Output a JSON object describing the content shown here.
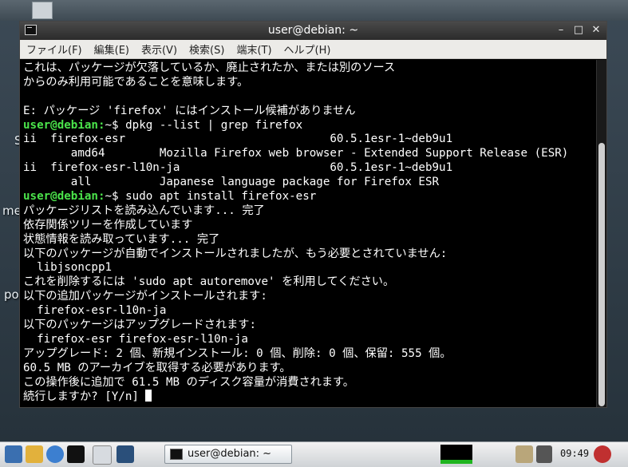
{
  "window": {
    "title": "user@debian: ~",
    "minimize_glyph": "–",
    "maximize_glyph": "□",
    "close_glyph": "✕"
  },
  "menu": [
    "ファイル(F)",
    "編集(E)",
    "表示(V)",
    "検索(S)",
    "端末(T)",
    "ヘルプ(H)"
  ],
  "terminal": {
    "lines": [
      {
        "text": "これは、パッケージが欠落しているか、廃止されたか、または別のソース"
      },
      {
        "text": "からのみ利用可能であることを意味します。"
      },
      {
        "text": ""
      },
      {
        "text": "E: パッケージ 'firefox' にはインストール候補がありません"
      },
      {
        "prompt": "user@debian:",
        "text": "~$ dpkg --list | grep firefox"
      },
      {
        "text": "ii  firefox-esr                              60.5.1esr-1~deb9u1"
      },
      {
        "text": "       amd64        Mozilla Firefox web browser - Extended Support Release (ESR)"
      },
      {
        "text": "ii  firefox-esr-l10n-ja                      60.5.1esr-1~deb9u1"
      },
      {
        "text": "       all          Japanese language package for Firefox ESR"
      },
      {
        "prompt": "user@debian:",
        "text": "~$ sudo apt install firefox-esr"
      },
      {
        "text": "パッケージリストを読み込んでいます... 完了"
      },
      {
        "text": "依存関係ツリーを作成しています"
      },
      {
        "text": "状態情報を読み取っています... 完了"
      },
      {
        "text": "以下のパッケージが自動でインストールされましたが、もう必要とされていません:"
      },
      {
        "text": "  libjsoncpp1"
      },
      {
        "text": "これを削除するには 'sudo apt autoremove' を利用してください。"
      },
      {
        "text": "以下の追加パッケージがインストールされます:"
      },
      {
        "text": "  firefox-esr-l10n-ja"
      },
      {
        "text": "以下のパッケージはアップグレードされます:"
      },
      {
        "text": "  firefox-esr firefox-esr-l10n-ja"
      },
      {
        "text": "アップグレード: 2 個、新規インストール: 0 個、削除: 0 個、保留: 555 個。"
      },
      {
        "text": "60.5 MB のアーカイブを取得する必要があります。"
      },
      {
        "text": "この操作後に追加で 61.5 MB のディスク容量が消費されます。"
      },
      {
        "text": "続行しますか? [Y/n] ",
        "cursor": true
      }
    ]
  },
  "desktop": {
    "labels": [
      "Si",
      "me",
      "po"
    ]
  },
  "taskbar": {
    "task_label": "user@debian: ~",
    "clock": "09:49"
  },
  "colors": {
    "prompt": "#4be34b",
    "terminal_bg": "#000000",
    "terminal_fg": "#ffffff"
  }
}
